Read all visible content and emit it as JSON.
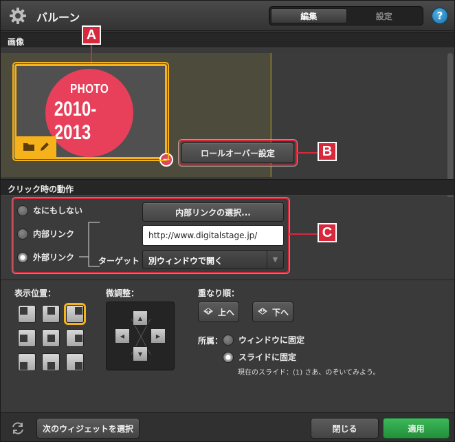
{
  "window": {
    "title": "バルーン"
  },
  "tabs": {
    "edit": "編集",
    "settings": "設定"
  },
  "help_label": "?",
  "image_section": {
    "header": "画像",
    "thumbnail_line1": "PHOTO",
    "thumbnail_line2": "2010-2013",
    "rollover_button": "ロールオーバー設定"
  },
  "annotations": {
    "a": "A",
    "b": "B",
    "c": "C"
  },
  "click_section": {
    "header": "クリック時の動作",
    "options": [
      "なにもしない",
      "内部リンク",
      "外部リンク"
    ],
    "selected_option": "外部リンク",
    "internal_link_button": "内部リンクの選択...",
    "url_value": "http://www.digitalstage.jp/",
    "target_label": "ターゲット",
    "target_value": "別ウィンドウで開く"
  },
  "display_position": {
    "label": "表示位置："
  },
  "fine_adjust": {
    "label": "微調整："
  },
  "stacking": {
    "label": "重なり順：",
    "up": "上へ",
    "down": "下へ"
  },
  "affiliation": {
    "label": "所属：",
    "options": [
      "ウィンドウに固定",
      "スライドに固定"
    ],
    "selected": "スライドに固定",
    "current_slide": "現在のスライド：(1) さあ、のぞいてみよう。"
  },
  "footer": {
    "select_next": "次のウィジェットを選択",
    "close": "閉じる",
    "apply": "適用"
  },
  "colors": {
    "accent": "#f5b21a",
    "annotation": "#d8283c",
    "apply": "#2fa84a"
  }
}
